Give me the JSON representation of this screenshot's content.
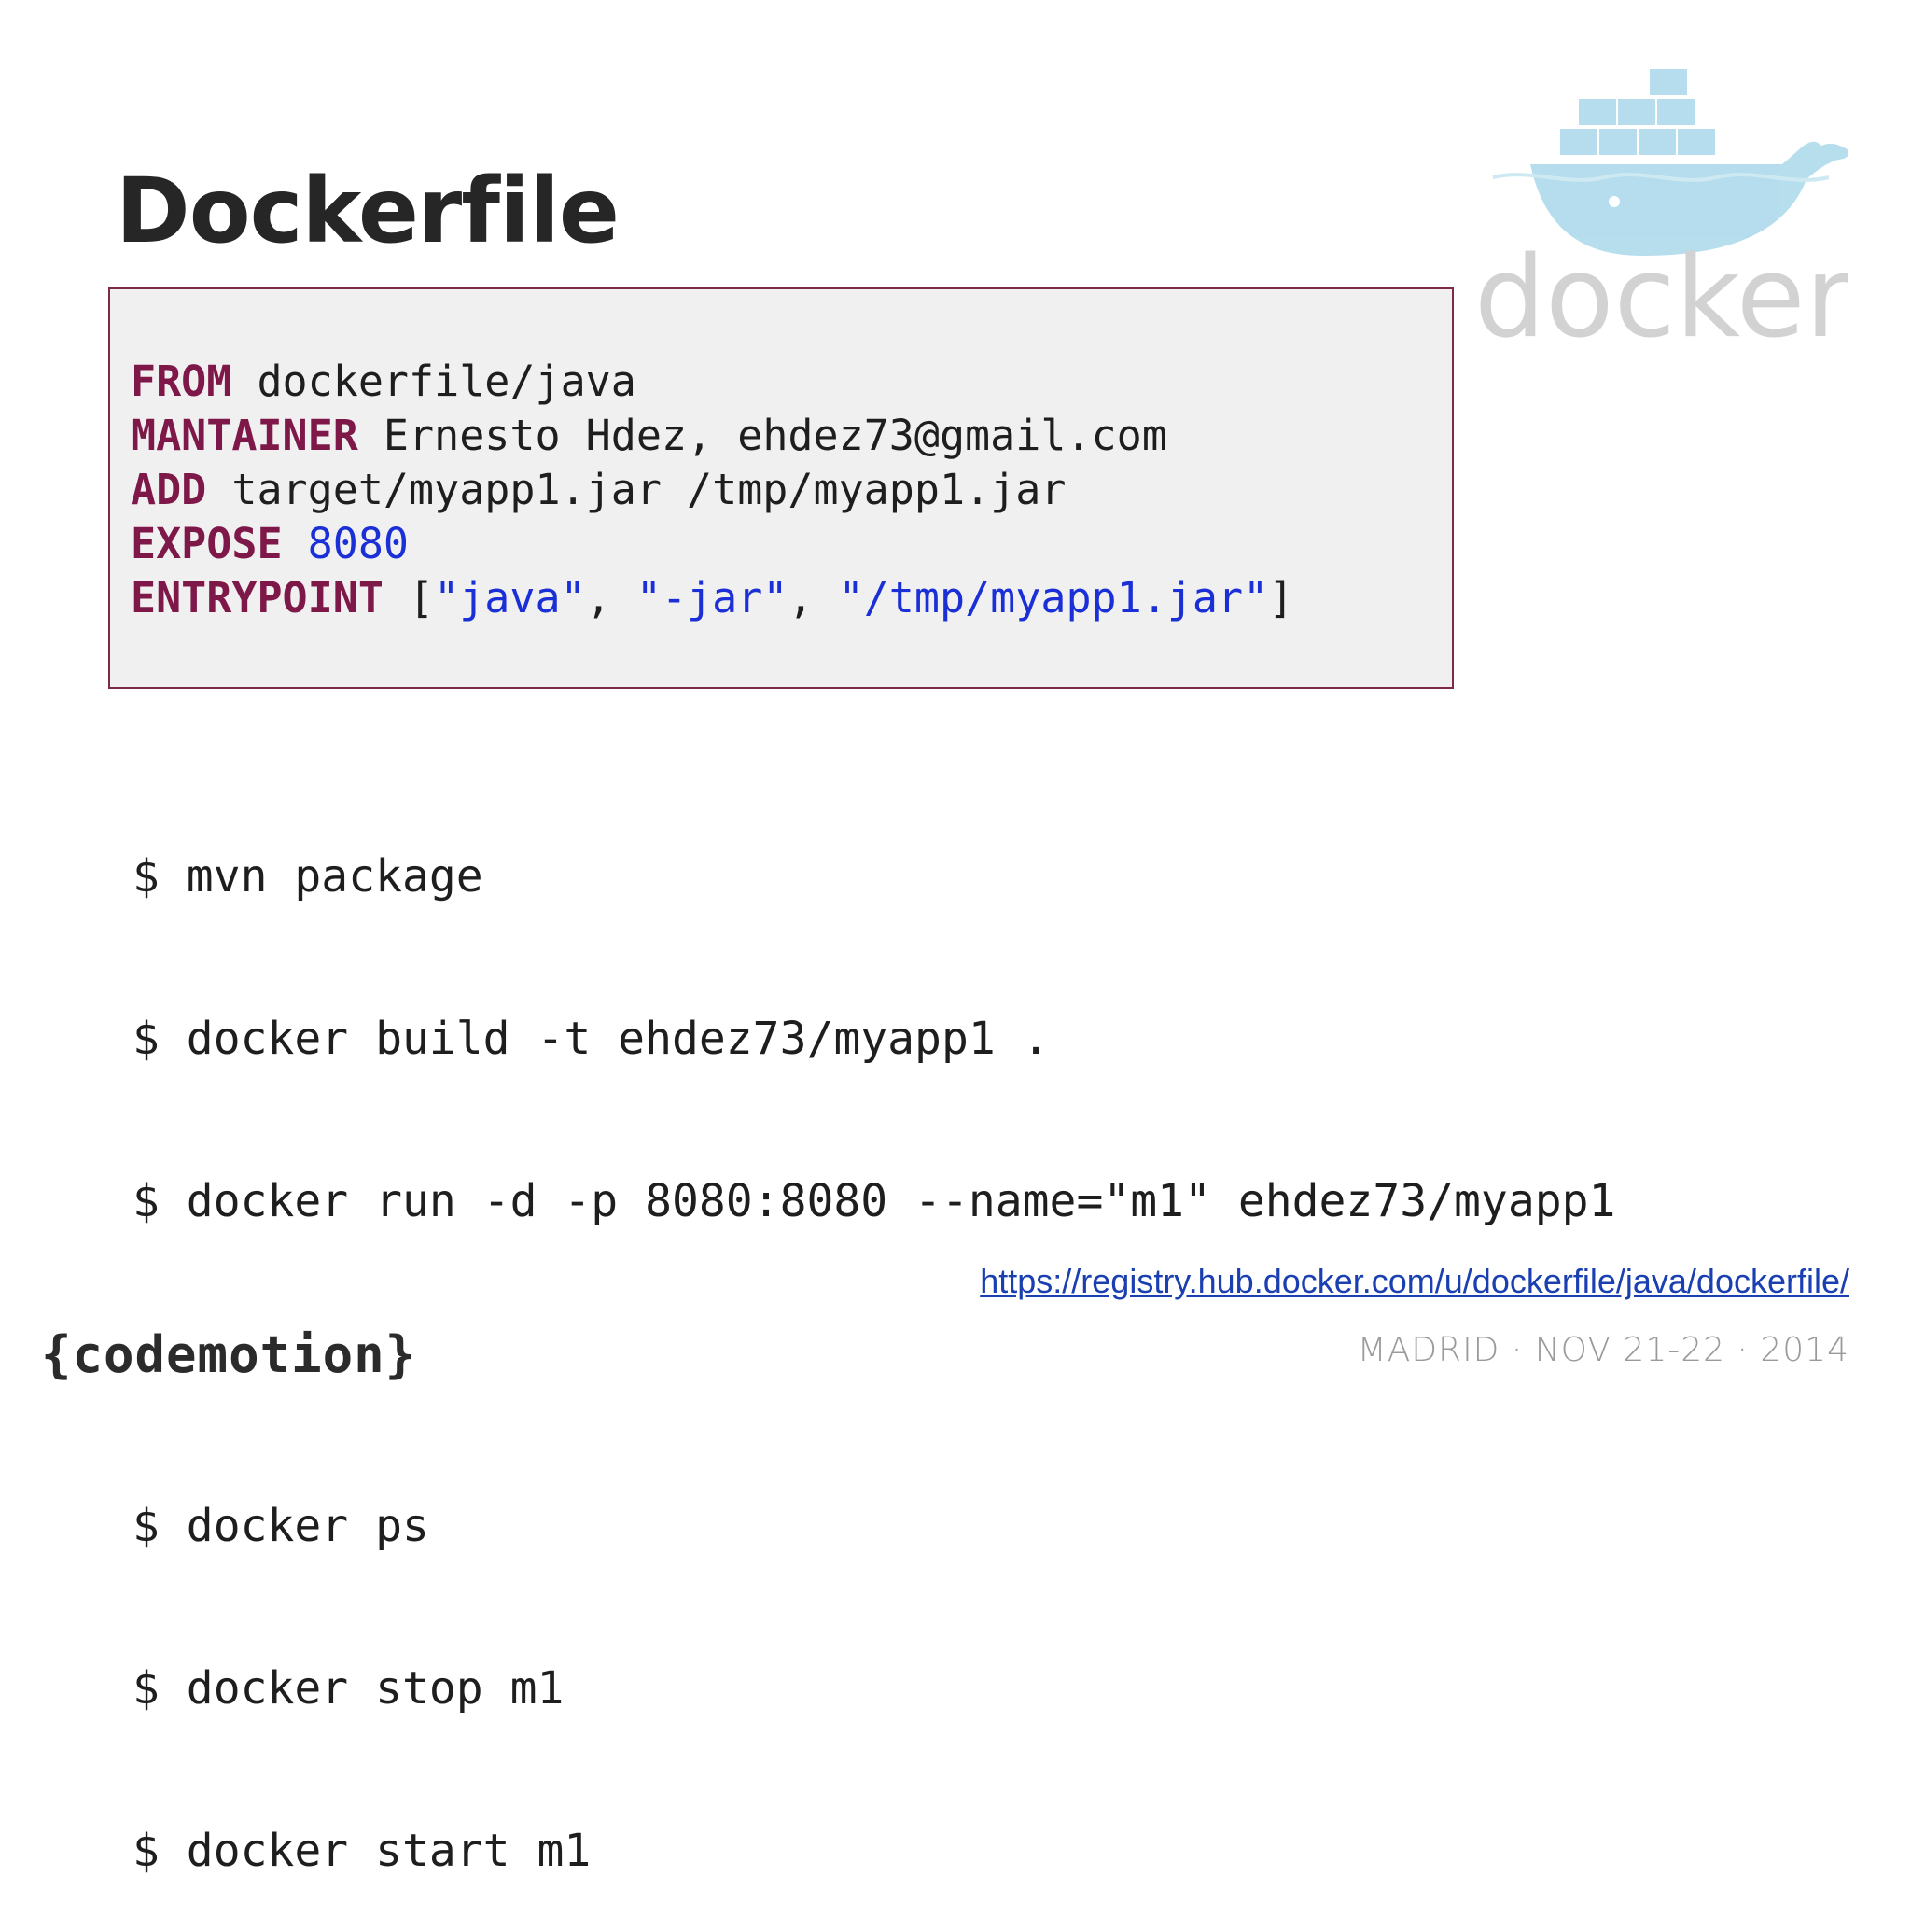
{
  "slide": {
    "title": "Dockerfile"
  },
  "dockerfile": {
    "lines": [
      [
        {
          "t": "FROM",
          "c": "kw"
        },
        {
          "t": " dockerfile/java",
          "c": ""
        }
      ],
      [
        {
          "t": "MANTAINER",
          "c": "kw"
        },
        {
          "t": " Ernesto Hdez, ehdez73@gmail.com",
          "c": ""
        }
      ],
      [
        {
          "t": "ADD",
          "c": "kw"
        },
        {
          "t": " target/myapp1.jar /tmp/myapp1.jar",
          "c": ""
        }
      ],
      [
        {
          "t": "EXPOSE",
          "c": "kw"
        },
        {
          "t": " ",
          "c": ""
        },
        {
          "t": "8080",
          "c": "num"
        }
      ],
      [
        {
          "t": "ENTRYPOINT",
          "c": "kw"
        },
        {
          "t": " [",
          "c": ""
        },
        {
          "t": "\"java\"",
          "c": "str"
        },
        {
          "t": ", ",
          "c": ""
        },
        {
          "t": "\"-jar\"",
          "c": "str"
        },
        {
          "t": ", ",
          "c": ""
        },
        {
          "t": "\"/tmp/myapp1.jar\"",
          "c": "str"
        },
        {
          "t": "]",
          "c": ""
        }
      ]
    ]
  },
  "commands": {
    "group1": [
      "$ mvn package",
      "$ docker build -t ehdez73/myapp1 .",
      "$ docker run -d -p 8080:8080 --name=\"m1\" ehdez73/myapp1"
    ],
    "group2": [
      "$ docker ps",
      "$ docker stop m1",
      "$ docker start m1"
    ]
  },
  "footer": {
    "link": "https://registry.hub.docker.com/u/dockerfile/java/dockerfile/",
    "event": "MADRID · NOV 21-22 · 2014",
    "brand": "{codemotion}"
  },
  "logo": {
    "icon": "docker-whale-icon",
    "text": "docker",
    "color": "#a9d8ea",
    "text_color": "#d2d2d2"
  },
  "colors": {
    "keyword": "#7d1848",
    "string": "#1a2fd6",
    "box_border": "#7d2a4a",
    "box_bg": "#f1f0f1"
  }
}
